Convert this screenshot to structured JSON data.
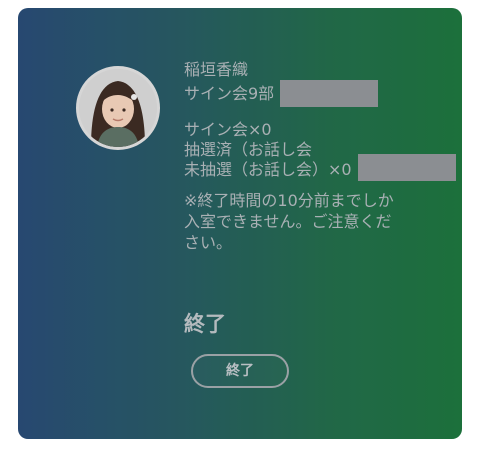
{
  "member": {
    "name": "稲垣香織",
    "event": "サイン会9部",
    "avatar": "member-photo"
  },
  "tickets": {
    "sign_session": "サイン会×0",
    "drawn_talk": "抽選済（お話し会",
    "undrawn_talk": "未抽選（お話し会）×0"
  },
  "note": "※終了時間の10分前までしか入室できません。ご注意ください。",
  "status": "終了",
  "button": {
    "label": "終了"
  },
  "colors": {
    "gradient_left": "#2b4f7b",
    "gradient_right": "#1f7a41",
    "text": "#a9b0b4",
    "redaction": "#8b8e92"
  }
}
